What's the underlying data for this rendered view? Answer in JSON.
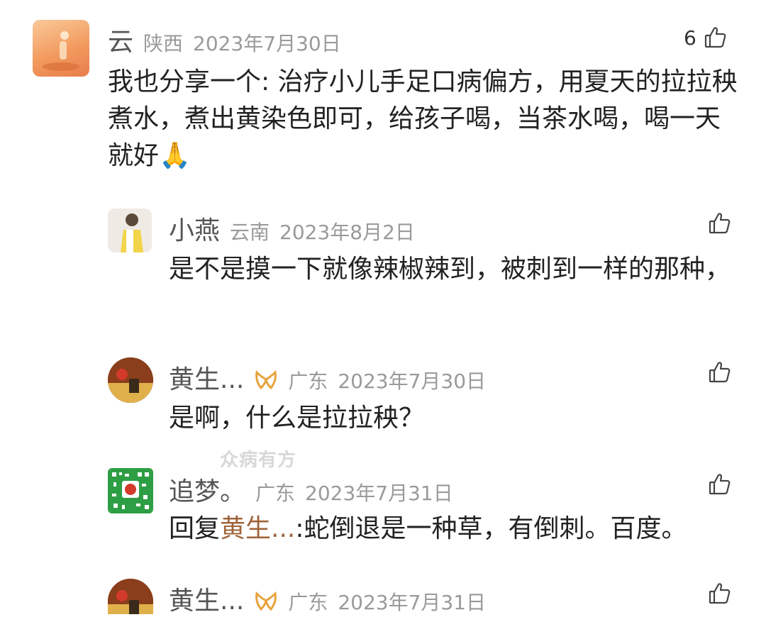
{
  "comments": [
    {
      "name": "云",
      "location": "陕西",
      "date": "2023年7月30日",
      "likes": "6",
      "text": "我也分享一个: 治疗小儿手足口病偏方，用夏天的拉拉秧煮水，煮出黄染色即可，给孩子喝，当茶水喝，喝一天就好🙏",
      "avatar_colors": [
        "#f6b27e",
        "#e77d4a"
      ]
    },
    {
      "name": "小燕",
      "location": "云南",
      "date": "2023年8月2日",
      "text": "是不是摸一下就像辣椒辣到，被刺到一样的那种，",
      "avatar_colors": [
        "#e9e4da",
        "#d8b83a"
      ]
    },
    {
      "name": "黄生...",
      "location": "广东",
      "date": "2023年7月30日",
      "text": "是啊，什么是拉拉秧？",
      "badge_color": "#e8a23a",
      "avatar_colors": [
        "#7a3b1e",
        "#e0b14a"
      ]
    },
    {
      "name": "追梦。",
      "location": "广东",
      "date": "2023年7月31日",
      "reply_prefix": "回复",
      "reply_to": "黄生...",
      "reply_text": ":蛇倒退是一种草，有倒刺。百度。",
      "avatar_colors": [
        "#2e9e44",
        "#ffffff"
      ]
    },
    {
      "name": "黄生...",
      "location": "广东",
      "date": "2023年7月31日",
      "badge_color": "#e8a23a",
      "avatar_colors": [
        "#7a3b1e",
        "#e0b14a"
      ]
    }
  ],
  "watermark": "众病有方",
  "icons": {
    "like": "thumbs-up-icon",
    "badge": "gold-ribbon-icon"
  },
  "colors": {
    "text": "#222222",
    "meta": "#9a9a9a",
    "reply_link": "#a0643a"
  }
}
